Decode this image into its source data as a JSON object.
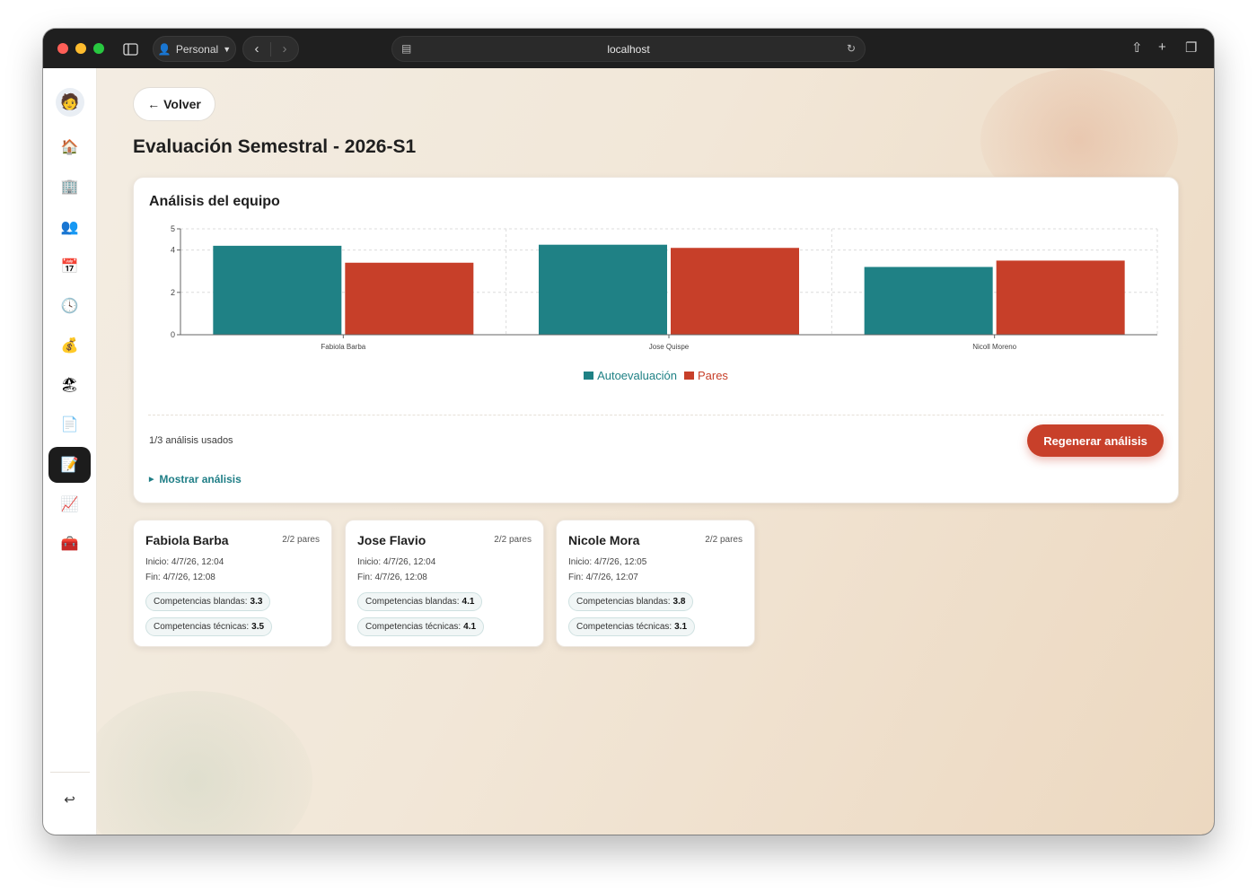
{
  "browser": {
    "profile_label": "Personal",
    "url": "localhost"
  },
  "page": {
    "back_label": "Volver",
    "title": "Evaluación Semestral - 2026-S1"
  },
  "analysis_card": {
    "title": "Análisis del equipo",
    "usage_text": "1/3 análisis usados",
    "regenerate_label": "Regenerar análisis",
    "show_label": "Mostrar análisis"
  },
  "chart_data": {
    "type": "bar",
    "categories": [
      "Fabiola Barba",
      "Jose Quispe",
      "Nicoll Moreno"
    ],
    "series": [
      {
        "name": "Autoevaluación",
        "values": [
          4.2,
          4.25,
          3.2
        ],
        "color": "#1f8185"
      },
      {
        "name": "Pares",
        "values": [
          3.4,
          4.1,
          3.5
        ],
        "color": "#c73f29"
      }
    ],
    "yticks": [
      0,
      2,
      4,
      5
    ],
    "ylim": [
      0,
      5
    ],
    "grid": true,
    "legend_position": "bottom"
  },
  "people": [
    {
      "name": "Fabiola Barba",
      "pares": "2/2 pares",
      "inicio": "Inicio: 4/7/26, 12:04",
      "fin": "Fin: 4/7/26, 12:08",
      "soft_label": "Competencias blandas:",
      "soft_value": "3.3",
      "tech_label": "Competencias técnicas:",
      "tech_value": "3.5"
    },
    {
      "name": "Jose Flavio",
      "pares": "2/2 pares",
      "inicio": "Inicio: 4/7/26, 12:04",
      "fin": "Fin: 4/7/26, 12:08",
      "soft_label": "Competencias blandas:",
      "soft_value": "4.1",
      "tech_label": "Competencias técnicas:",
      "tech_value": "4.1"
    },
    {
      "name": "Nicole Mora",
      "pares": "2/2 pares",
      "inicio": "Inicio: 4/7/26, 12:05",
      "fin": "Fin: 4/7/26, 12:07",
      "soft_label": "Competencias blandas:",
      "soft_value": "3.8",
      "tech_label": "Competencias técnicas:",
      "tech_value": "3.1"
    }
  ],
  "sidebar": {
    "icons": [
      "home-icon",
      "building-icon",
      "people-icon",
      "calendar-icon",
      "clock-icon",
      "money-bag-icon",
      "beach-umbrella-icon",
      "document-icon",
      "memo-icon",
      "chart-icon",
      "toolbox-icon"
    ],
    "active_index": 8
  }
}
